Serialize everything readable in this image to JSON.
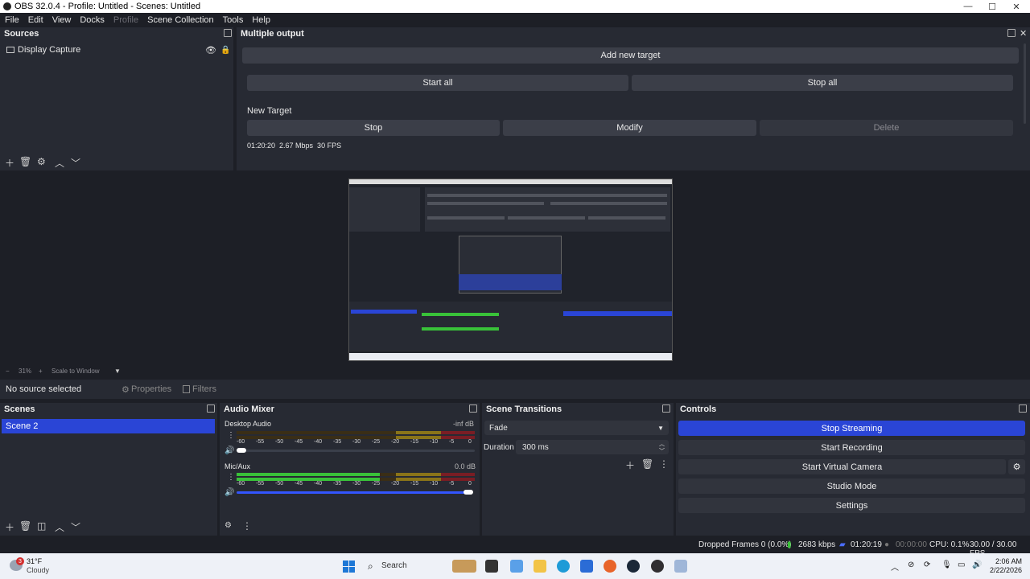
{
  "window": {
    "title": "OBS 32.0.4 - Profile: Untitled - Scenes: Untitled"
  },
  "menu": [
    {
      "label": "File",
      "enabled": true
    },
    {
      "label": "Edit",
      "enabled": true
    },
    {
      "label": "View",
      "enabled": true
    },
    {
      "label": "Docks",
      "enabled": true
    },
    {
      "label": "Profile",
      "enabled": false
    },
    {
      "label": "Scene Collection",
      "enabled": true
    },
    {
      "label": "Tools",
      "enabled": true
    },
    {
      "label": "Help",
      "enabled": true
    }
  ],
  "sources": {
    "title": "Sources",
    "items": [
      {
        "label": "Display Capture"
      }
    ]
  },
  "multiple_output": {
    "title": "Multiple output",
    "add_target": "Add new target",
    "start_all": "Start all",
    "stop_all": "Stop all",
    "target_name": "New Target",
    "stop": "Stop",
    "modify": "Modify",
    "delete": "Delete",
    "stats": "01:20:20  2.67 Mbps  30 FPS"
  },
  "scale_bar": {
    "zoom": "31%",
    "mode": "Scale to Window"
  },
  "source_bar": {
    "status": "No source selected",
    "properties": "Properties",
    "filters": "Filters"
  },
  "scenes": {
    "title": "Scenes",
    "items": [
      {
        "label": "Scene 2",
        "selected": true
      }
    ]
  },
  "audio_mixer": {
    "title": "Audio Mixer",
    "scale": [
      "-60",
      "-55",
      "-50",
      "-45",
      "-40",
      "-35",
      "-30",
      "-25",
      "-20",
      "-15",
      "-10",
      "-5",
      "0"
    ],
    "channels": [
      {
        "name": "Desktop Audio",
        "level": "-inf dB",
        "muted": false,
        "volume": 0.02,
        "meter": 0.0
      },
      {
        "name": "Mic/Aux",
        "level": "0.0 dB",
        "muted": false,
        "volume": 1.0,
        "meter": 0.6
      }
    ]
  },
  "scene_transitions": {
    "title": "Scene Transitions",
    "transition": "Fade",
    "duration_label": "Duration",
    "duration_value": "300 ms"
  },
  "controls": {
    "title": "Controls",
    "stop_streaming": "Stop Streaming",
    "start_recording": "Start Recording",
    "start_virtual_camera": "Start Virtual Camera",
    "studio_mode": "Studio Mode",
    "settings": "Settings"
  },
  "status": {
    "dropped_frames": "Dropped Frames 0 (0.0%)",
    "bitrate": "2683 kbps",
    "stream_time": "01:20:19",
    "record_time": "00:00:00",
    "cpu": "CPU: 0.1%",
    "fps": "30.00 / 30.00 FPS"
  },
  "taskbar": {
    "weather_temp": "31°F",
    "weather_desc": "Cloudy",
    "notification_count": "3",
    "search": "Search",
    "time": "2:06 AM",
    "date": "2/22/2026"
  },
  "colors": {
    "accent": "#2a45d6",
    "panel": "#272a33",
    "background": "#1d1f26",
    "button": "#3b3e48"
  }
}
